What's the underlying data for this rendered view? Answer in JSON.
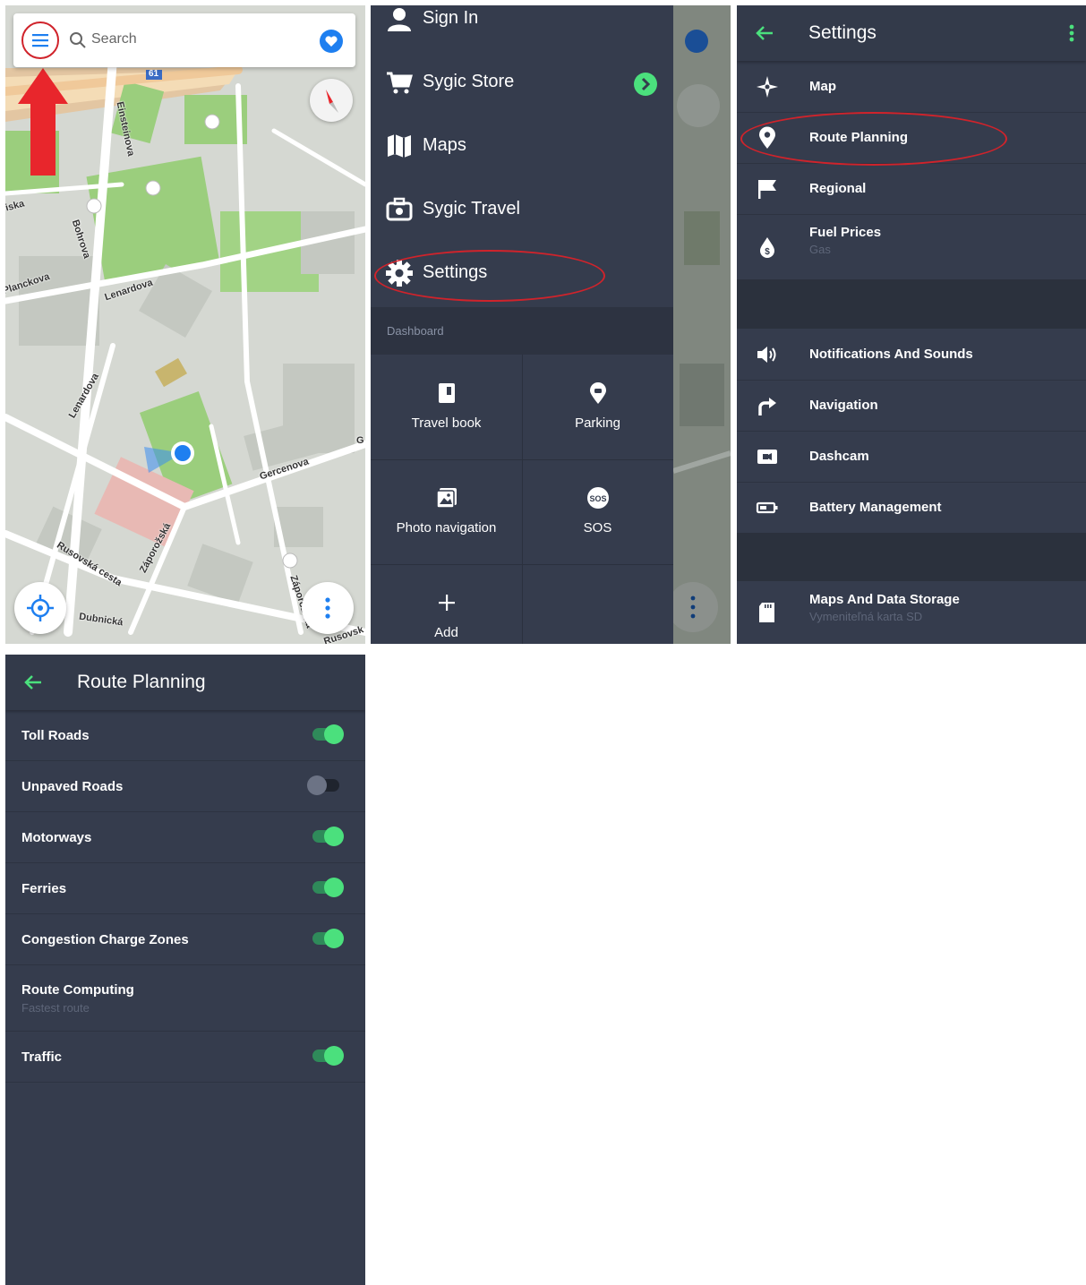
{
  "map_panel": {
    "search_placeholder": "Search",
    "road_number": "61",
    "street_labels": {
      "einsteinova": "Einsteinova",
      "bohrova": "Bohrova",
      "planckova": "Planckova",
      "lenardova_top": "Lenardova",
      "lenardova_left": "Lenardova",
      "gercenova": "Gercenova",
      "rusovska": "Rusovská cesta",
      "zaporozska_left": "Záporožská",
      "zaporozska_right": "Záporožská",
      "dubnicka": "Dubnická",
      "rusovsk_edge": "Rusovsk",
      "iska": "iska",
      "ei": "Ei",
      "g": "G"
    },
    "colors": {
      "accent": "#1e7ff0",
      "arrow": "#e8262c"
    }
  },
  "menu_panel": {
    "items": [
      {
        "label": "Sign In",
        "icon": "person-icon"
      },
      {
        "label": "Sygic Store",
        "icon": "cart-icon"
      },
      {
        "label": "Maps",
        "icon": "map-icon"
      },
      {
        "label": "Sygic Travel",
        "icon": "suitcase-icon"
      },
      {
        "label": "Settings",
        "icon": "gear-icon"
      }
    ],
    "dashboard_title": "Dashboard",
    "dashboard": [
      {
        "label": "Travel book",
        "icon": "book-icon"
      },
      {
        "label": "Parking",
        "icon": "parking-pin-icon"
      },
      {
        "label": "Photo navigation",
        "icon": "photo-icon"
      },
      {
        "label": "SOS",
        "icon": "sos-icon"
      },
      {
        "label": "Add",
        "icon": "plus-icon"
      }
    ]
  },
  "settings_panel": {
    "title": "Settings",
    "items": [
      {
        "label": "Map",
        "sub": "",
        "icon": "compass-rose-icon"
      },
      {
        "label": "Route Planning",
        "sub": "",
        "icon": "pin-icon"
      },
      {
        "label": "Regional",
        "sub": "",
        "icon": "flag-icon"
      },
      {
        "label": "Fuel Prices",
        "sub": "Gas",
        "icon": "fuel-drop-icon"
      },
      {
        "label": "Notifications And Sounds",
        "sub": "",
        "icon": "speaker-icon"
      },
      {
        "label": "Navigation",
        "sub": "",
        "icon": "turn-arrow-icon"
      },
      {
        "label": "Dashcam",
        "sub": "",
        "icon": "camera-icon"
      },
      {
        "label": "Battery Management",
        "sub": "",
        "icon": "battery-icon"
      },
      {
        "label": "Maps And Data Storage",
        "sub": "Vymeniteľná karta SD",
        "icon": "sd-card-icon"
      }
    ],
    "colors": {
      "accent": "#4be07d"
    }
  },
  "route_panel": {
    "title": "Route Planning",
    "rows": [
      {
        "label": "Toll Roads",
        "toggle": true
      },
      {
        "label": "Unpaved Roads",
        "toggle": false
      },
      {
        "label": "Motorways",
        "toggle": true
      },
      {
        "label": "Ferries",
        "toggle": true
      },
      {
        "label": "Congestion Charge Zones",
        "toggle": true
      },
      {
        "label": "Route Computing",
        "sub": "Fastest route"
      },
      {
        "label": "Traffic",
        "toggle": true
      }
    ]
  }
}
